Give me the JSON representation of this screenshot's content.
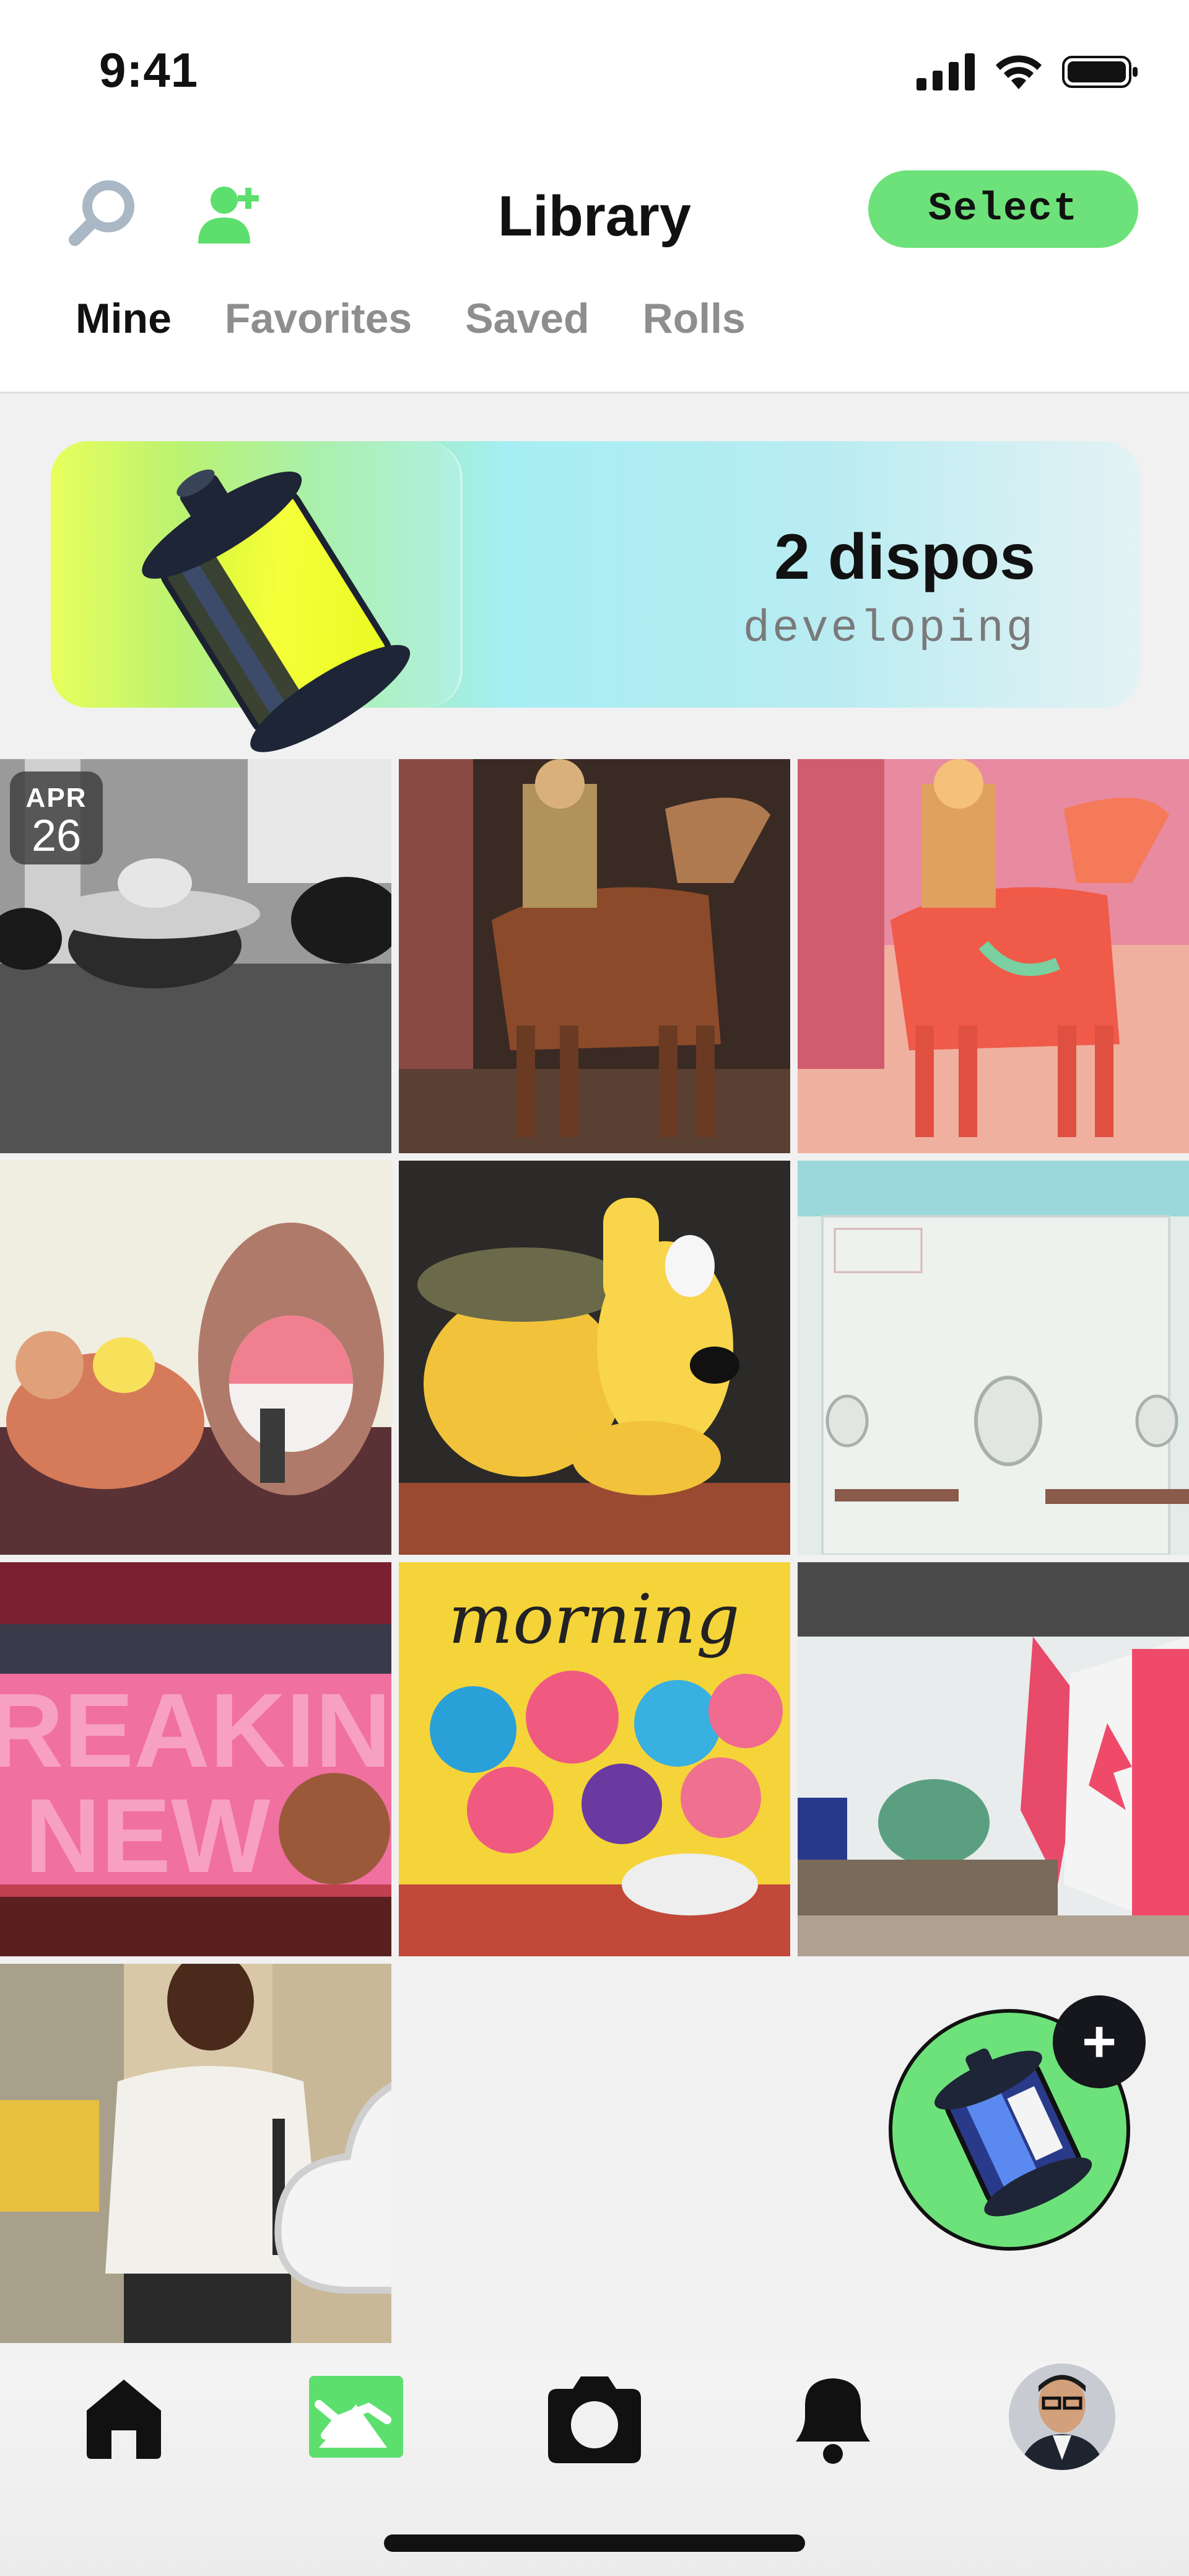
{
  "status_bar": {
    "time": "9:41"
  },
  "header": {
    "title": "Library",
    "select_label": "Select",
    "tabs": [
      {
        "label": "Mine",
        "active": true
      },
      {
        "label": "Favorites",
        "active": false
      },
      {
        "label": "Saved",
        "active": false
      },
      {
        "label": "Rolls",
        "active": false
      }
    ],
    "left_icons": [
      "search-icon",
      "add-friend-icon"
    ]
  },
  "developing_banner": {
    "count_label": "2 dispos",
    "status_label": "developing"
  },
  "photos": [
    {
      "name": "photo-gold-ingot",
      "badge": {
        "month": "APR",
        "day": "26"
      }
    },
    {
      "name": "photo-woody-horse-1"
    },
    {
      "name": "photo-woody-horse-2"
    },
    {
      "name": "photo-plush-toys"
    },
    {
      "name": "photo-pluto-garfield"
    },
    {
      "name": "photo-light-switch"
    },
    {
      "name": "photo-breaking-news"
    },
    {
      "name": "photo-morning-painting"
    },
    {
      "name": "photo-flags"
    },
    {
      "name": "photo-man-sweater",
      "status_icon": "cloud-x-icon"
    }
  ],
  "fab": {
    "plus_label": "+",
    "icon": "dispo-canister-icon"
  },
  "tab_bar": {
    "items": [
      "home-icon",
      "library-icon",
      "camera-icon",
      "bell-icon",
      "profile-avatar"
    ],
    "active": "library-icon"
  },
  "colors": {
    "accent": "#6de27a",
    "text": "#111111",
    "muted": "#8e8e8e",
    "background": "#f1f1f1"
  }
}
